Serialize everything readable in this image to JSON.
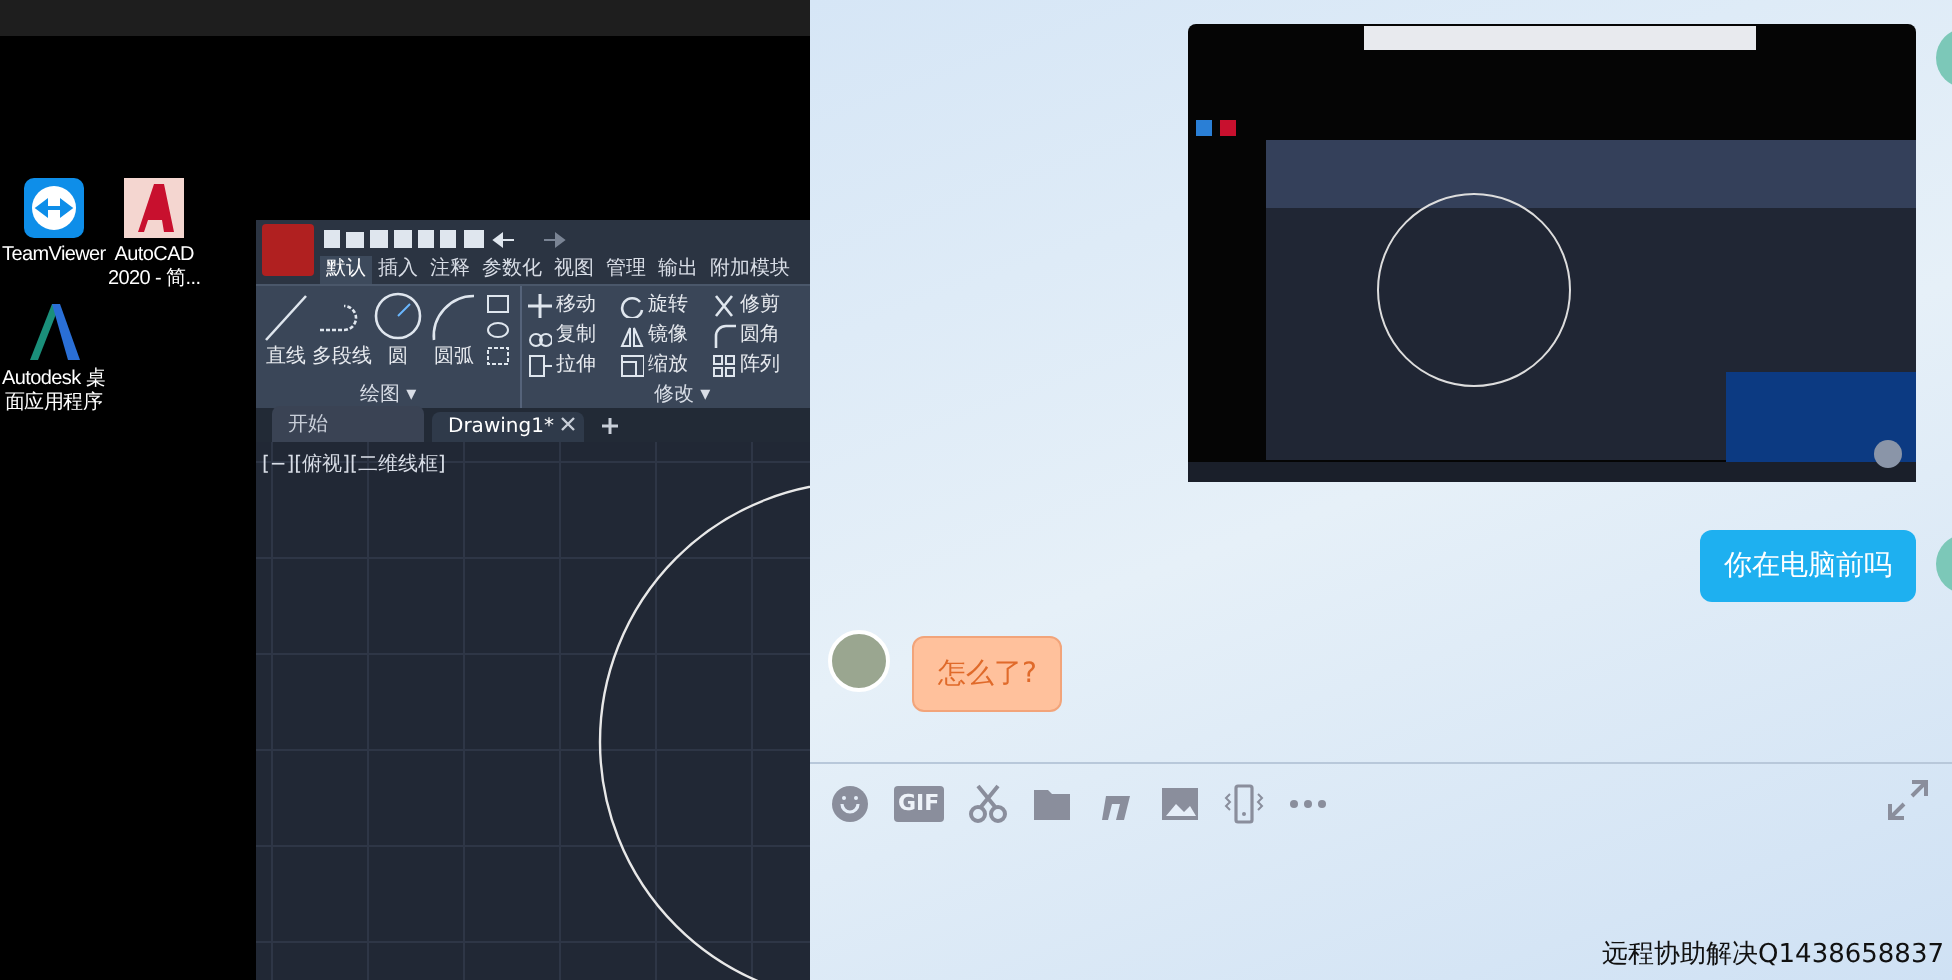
{
  "desktop": {
    "icons": [
      {
        "kind": "teamviewer",
        "label_lines": [
          "TeamViewer"
        ]
      },
      {
        "kind": "autocad",
        "label_lines": [
          "AutoCAD",
          "2020 - 简..."
        ]
      },
      {
        "kind": "autodesk",
        "label_lines": [
          "Autodesk 桌",
          "面应用程序"
        ]
      }
    ]
  },
  "cad_window": {
    "ribbon_tabs": [
      {
        "label": "默认",
        "selected": true
      },
      {
        "label": "插入",
        "selected": false
      },
      {
        "label": "注释",
        "selected": false
      },
      {
        "label": "参数化",
        "selected": false
      },
      {
        "label": "视图",
        "selected": false
      },
      {
        "label": "管理",
        "selected": false
      },
      {
        "label": "输出",
        "selected": false
      },
      {
        "label": "附加模块",
        "selected": false
      }
    ],
    "draw_panel": {
      "tools": [
        {
          "kind": "line",
          "label": "直线"
        },
        {
          "kind": "polyline",
          "label": "多段线"
        },
        {
          "kind": "circle",
          "label": "圆"
        },
        {
          "kind": "arc",
          "label": "圆弧"
        }
      ],
      "title": "绘图 ▾"
    },
    "modify_panel": {
      "rows": [
        [
          {
            "kind": "move",
            "label": "移动"
          },
          {
            "kind": "rotate",
            "label": "旋转"
          },
          {
            "kind": "trim",
            "label": "修剪"
          }
        ],
        [
          {
            "kind": "copy",
            "label": "复制"
          },
          {
            "kind": "mirror",
            "label": "镜像"
          },
          {
            "kind": "fillet",
            "label": "圆角"
          }
        ],
        [
          {
            "kind": "stretch",
            "label": "拉伸"
          },
          {
            "kind": "scale",
            "label": "缩放"
          },
          {
            "kind": "array",
            "label": "阵列"
          }
        ]
      ],
      "title": "修改 ▾"
    },
    "file_tabs": [
      {
        "label": "开始",
        "selected": false
      },
      {
        "label": "Drawing1*",
        "selected": true
      }
    ],
    "viewport_label": "[−][俯视][二维线框]"
  },
  "chat": {
    "messages": [
      {
        "kind": "image",
        "outgoing": true
      },
      {
        "kind": "text",
        "outgoing": true,
        "text": "你在电脑前吗"
      },
      {
        "kind": "text",
        "outgoing": false,
        "text": "怎么了?"
      }
    ],
    "toolbar": {
      "gif_label": "GIF"
    },
    "footer_text": "远程协助解决Q1438658837"
  }
}
